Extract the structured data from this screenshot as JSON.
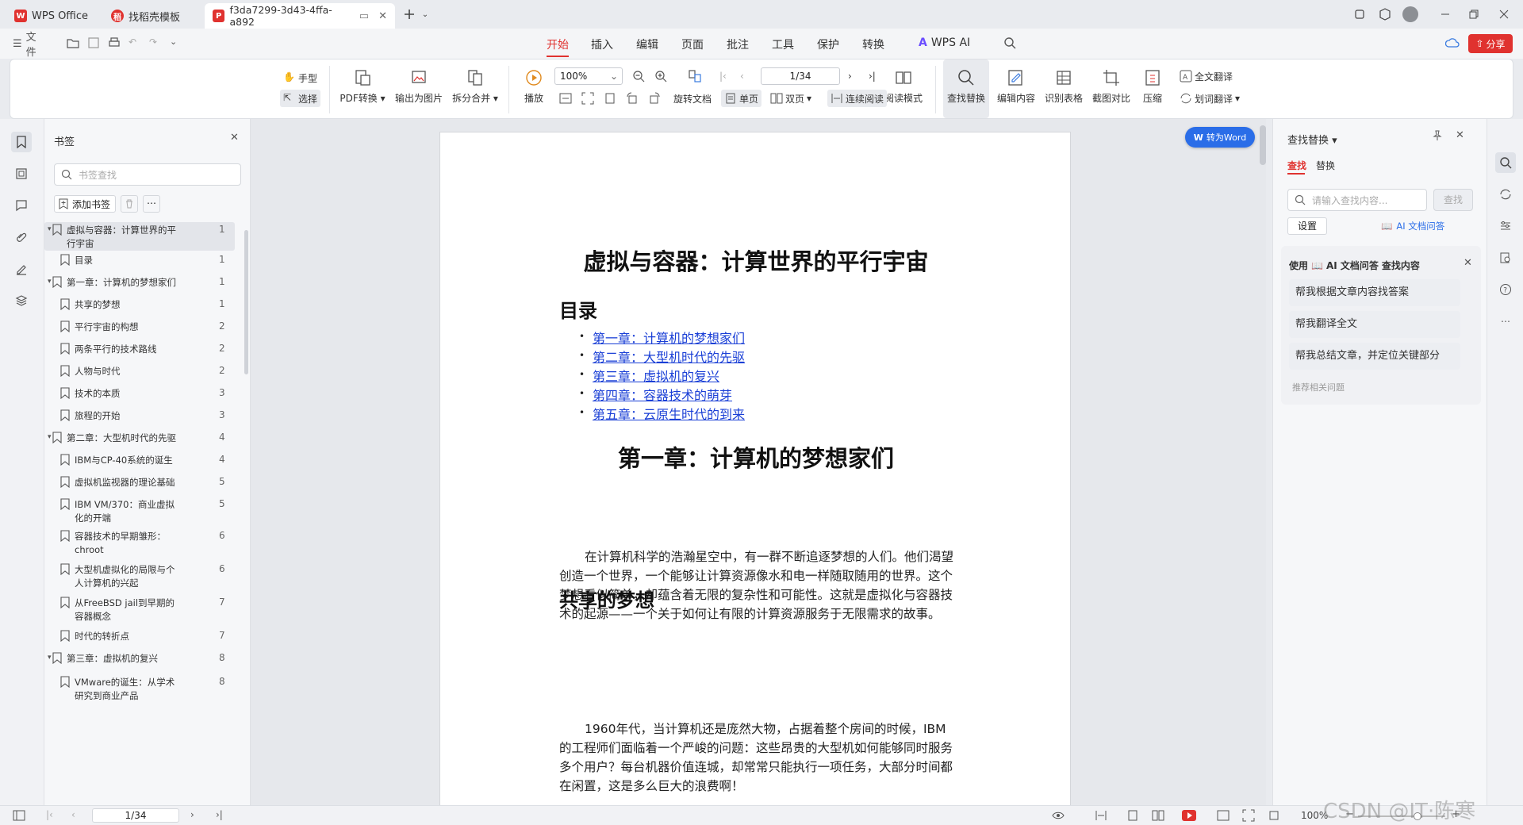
{
  "tabs": [
    {
      "label": "WPS Office",
      "logo": "W",
      "color": "#e0322f"
    },
    {
      "label": "找稻壳模板",
      "logo": "稻",
      "color": "#e0322f"
    },
    {
      "label": "f3da7299-3d43-4ffa-a892",
      "logo": "P",
      "color": "#e0322f"
    }
  ],
  "menu": {
    "file_label": "文件",
    "tabs": [
      "开始",
      "插入",
      "编辑",
      "页面",
      "批注",
      "工具",
      "保护",
      "转换"
    ],
    "ai_label": "WPS AI",
    "share_label": "分享"
  },
  "ribbon": {
    "hand": "手型",
    "select": "选择",
    "pdf_convert": "PDF转换",
    "export_image": "输出为图片",
    "split_merge": "拆分合并",
    "play": "播放",
    "zoom_value": "100%",
    "page_value": "1/34",
    "rotate": "旋转文档",
    "single_page": "单页",
    "double_page": "双页",
    "continuous": "连续阅读",
    "reading_mode": "阅读模式",
    "find_replace": "查找替换",
    "edit_content": "编辑内容",
    "recognize_table": "识别表格",
    "screenshot_compare": "截图对比",
    "compress": "压缩",
    "full_translate": "全文翻译",
    "word_translate": "划词翻译"
  },
  "bookmarks": {
    "title": "书签",
    "search_placeholder": "书签查找",
    "add_label": "添加书签",
    "items": [
      {
        "label": "虚拟与容器：计算世界的平行宇宙",
        "page": "1"
      },
      {
        "label": "目录",
        "page": "1"
      },
      {
        "label": "第一章：计算机的梦想家们",
        "page": "1"
      },
      {
        "label": "共享的梦想",
        "page": "1"
      },
      {
        "label": "平行宇宙的构想",
        "page": "2"
      },
      {
        "label": "两条平行的技术路线",
        "page": "2"
      },
      {
        "label": "人物与时代",
        "page": "2"
      },
      {
        "label": "技术的本质",
        "page": "3"
      },
      {
        "label": "旅程的开始",
        "page": "3"
      },
      {
        "label": "第二章：大型机时代的先驱",
        "page": "4"
      },
      {
        "label": "IBM与CP-40系统的诞生",
        "page": "4"
      },
      {
        "label": "虚拟机监视器的理论基础",
        "page": "5"
      },
      {
        "label": "IBM VM/370：商业虚拟化的开端",
        "page": "5"
      },
      {
        "label": "容器技术的早期雏形：chroot",
        "page": "6"
      },
      {
        "label": "大型机虚拟化的局限与个人计算机的兴起",
        "page": "6"
      },
      {
        "label": "从FreeBSD jail到早期的容器概念",
        "page": "7"
      },
      {
        "label": "时代的转折点",
        "page": "7"
      },
      {
        "label": "第三章：虚拟机的复兴",
        "page": "8"
      },
      {
        "label": "VMware的诞生：从学术研究到商业产品",
        "page": "8"
      }
    ]
  },
  "document": {
    "convert_word": "转为Word",
    "title": "虚拟与容器：计算世界的平行宇宙",
    "toc_heading": "目录",
    "toc": [
      "第一章：计算机的梦想家们",
      "第二章：大型机时代的先驱",
      "第三章：虚拟机的复兴",
      "第四章：容器技术的萌芽",
      "第五章：云原生时代的到来"
    ],
    "chapter1": "第一章：计算机的梦想家们",
    "para1": "在计算机科学的浩瀚星空中，有一群不断追逐梦想的人们。他们渴望创造一个世界，一个能够让计算资源像水和电一样随取随用的世界。这个梦想看似简单，却蕴含着无限的复杂性和可能性。这就是虚拟化与容器技术的起源——一个关于如何让有限的计算资源服务于无限需求的故事。",
    "section1": "共享的梦想",
    "para2": "1960年代，当计算机还是庞然大物，占据着整个房间的时候，IBM的工程师们面临着一个严峻的问题：这些昂贵的大型机如何能够同时服务多个用户？每台机器价值连城，却常常只能执行一项任务，大部分时间都在闲置，这是多么巨大的浪费啊！"
  },
  "find_panel": {
    "title": "查找替换",
    "tab_find": "查找",
    "tab_replace": "替换",
    "search_placeholder": "请输入查找内容...",
    "search_button": "查找",
    "settings_button": "设置",
    "ai_link": "AI 文档问答",
    "ai_header_prefix": "使用",
    "ai_header_name": "AI 文档问答",
    "ai_header_suffix": "查找内容",
    "ai_items": [
      "帮我根据文章内容找答案",
      "帮我翻译全文",
      "帮我总结文章，并定位关键部分"
    ],
    "ai_recommend": "推荐相关问题"
  },
  "status": {
    "page_value": "1/34",
    "zoom": "100%",
    "watermark": "CSDN @IT·陈寒"
  },
  "colors": {
    "accent": "#e0322f",
    "link": "#1a3fd6",
    "ai_blue": "#2a6de8"
  }
}
